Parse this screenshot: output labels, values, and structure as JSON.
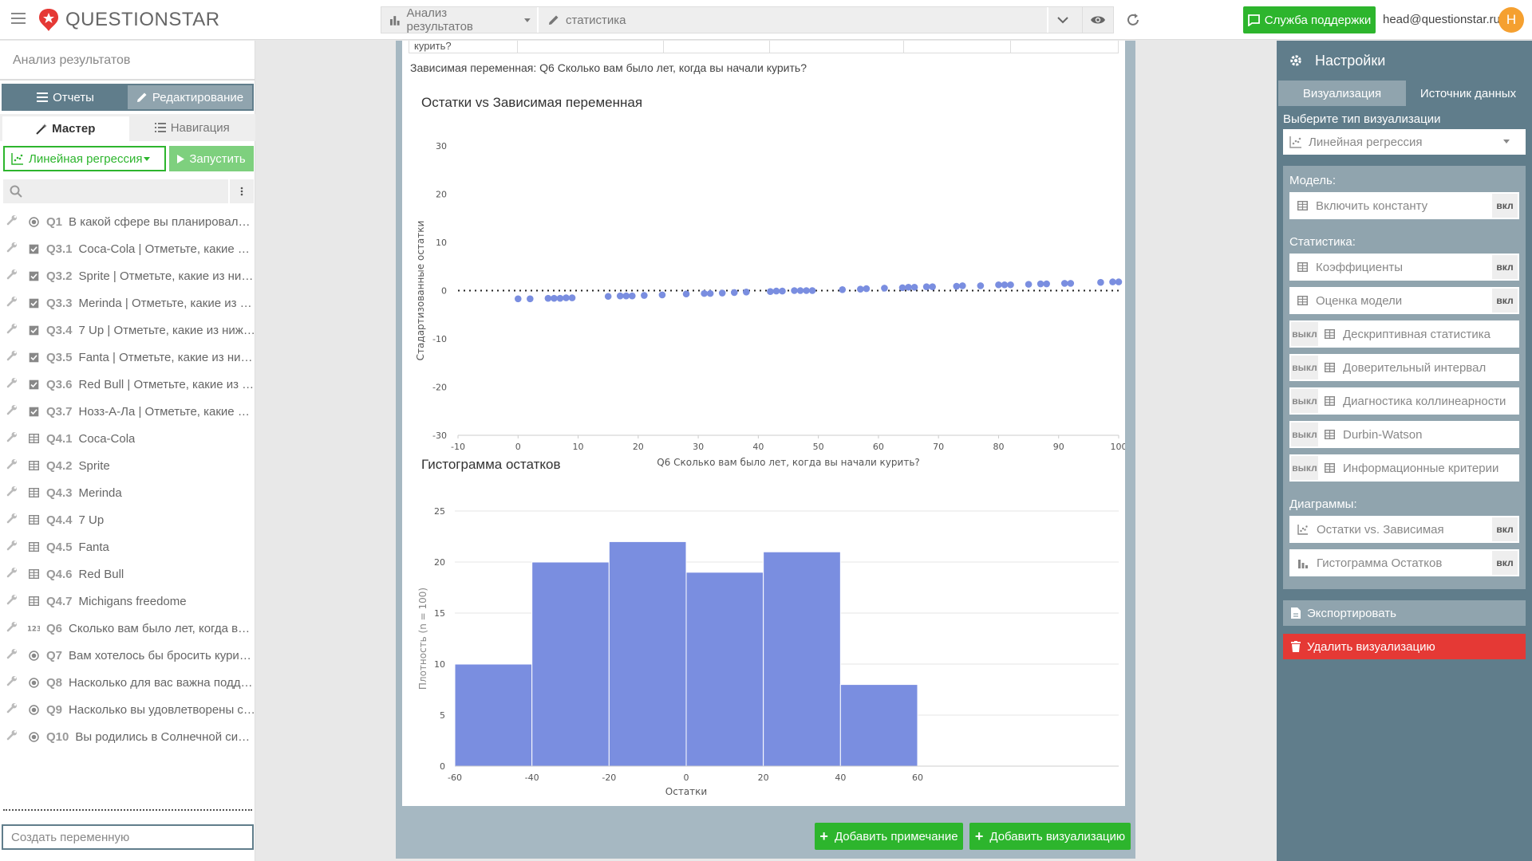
{
  "topbar": {
    "logo_text": "QUESTIONSTAR",
    "crumb_analysis": "Анализ результатов",
    "crumb_name": "статистика",
    "support_label": "Служба поддержки",
    "user_email": "head@questionstar.ru",
    "avatar_letter": "H",
    "brand_color": "#e53935",
    "accent_color": "#2db52d"
  },
  "sidebar": {
    "title": "Анализ результатов",
    "tab_reports": "Отчеты",
    "tab_edit": "Редактирование",
    "subtab_master": "Мастер",
    "subtab_nav": "Навигация",
    "analysis_type": "Линейная регрессия",
    "run_label": "Запустить",
    "new_var_placeholder": "Создать переменную",
    "items": [
      {
        "code": "Q1",
        "name": "В какой сфере вы планировали п...",
        "icon": "radio-icon"
      },
      {
        "code": "Q3.1",
        "name": "Coca-Cola | Отметьте, какие из ...",
        "icon": "checkbox-icon"
      },
      {
        "code": "Q3.2",
        "name": "Sprite | Отметьте, какие из ниже...",
        "icon": "checkbox-icon"
      },
      {
        "code": "Q3.3",
        "name": "Merinda | Отметьте, какие из ни...",
        "icon": "checkbox-icon"
      },
      {
        "code": "Q3.4",
        "name": "7 Up | Отметьте, какие из нижеп...",
        "icon": "checkbox-icon"
      },
      {
        "code": "Q3.5",
        "name": "Fanta | Отметьте, какие из ниже...",
        "icon": "checkbox-icon"
      },
      {
        "code": "Q3.6",
        "name": "Red Bull | Отметьте, какие из ни...",
        "icon": "checkbox-icon"
      },
      {
        "code": "Q3.7",
        "name": "Нозз-А-Ла | Отметьте, какие из ...",
        "icon": "checkbox-icon"
      },
      {
        "code": "Q4.1",
        "name": "Coca-Cola",
        "icon": "table-icon"
      },
      {
        "code": "Q4.2",
        "name": "Sprite",
        "icon": "table-icon"
      },
      {
        "code": "Q4.3",
        "name": "Merinda",
        "icon": "table-icon"
      },
      {
        "code": "Q4.4",
        "name": "7 Up",
        "icon": "table-icon"
      },
      {
        "code": "Q4.5",
        "name": "Fanta",
        "icon": "table-icon"
      },
      {
        "code": "Q4.6",
        "name": "Red Bull",
        "icon": "table-icon"
      },
      {
        "code": "Q4.7",
        "name": "Michigans freedome",
        "icon": "table-icon"
      },
      {
        "code": "Q6",
        "name": "Сколько вам было лет, когда вы ...",
        "icon": "numeric-icon"
      },
      {
        "code": "Q7",
        "name": "Вам хотелось бы бросить курить?",
        "icon": "radio-icon"
      },
      {
        "code": "Q8",
        "name": "Насколько для вас важна поддер...",
        "icon": "radio-icon"
      },
      {
        "code": "Q9",
        "name": "Насколько вы удовлетворены ст...",
        "icon": "radio-icon"
      },
      {
        "code": "Q10",
        "name": "Вы родились в Солнечной систе...",
        "icon": "radio-icon"
      }
    ]
  },
  "main": {
    "table_stub_text": "курить?",
    "dependent_var_text": "Зависимая переменная: Q6 Сколько вам было лет, когда вы начали курить?",
    "add_note_label": "Добавить примечание",
    "add_viz_label": "Добавить визуализацию"
  },
  "chart_data": [
    {
      "type": "scatter",
      "title": "Остатки vs Зависимая переменная",
      "xlabel": "Q6 Сколько вам было лет, когда вы начали курить?",
      "ylabel": "Стадартизованные остатки",
      "xlim": [
        -10,
        100
      ],
      "ylim": [
        -30,
        30
      ],
      "xticks": [
        -10,
        0,
        10,
        20,
        30,
        40,
        50,
        60,
        70,
        80,
        90,
        100
      ],
      "yticks": [
        30,
        20,
        10,
        0,
        -10,
        -20,
        -30
      ],
      "reference_line_y": 0,
      "color": "#7a8ee0",
      "points": [
        [
          0,
          -1.7
        ],
        [
          2,
          -1.7
        ],
        [
          5,
          -1.6
        ],
        [
          6,
          -1.6
        ],
        [
          7,
          -1.6
        ],
        [
          8,
          -1.5
        ],
        [
          9,
          -1.5
        ],
        [
          15,
          -1.2
        ],
        [
          17,
          -1.1
        ],
        [
          18,
          -1.1
        ],
        [
          19,
          -1.1
        ],
        [
          21,
          -1.0
        ],
        [
          24,
          -0.9
        ],
        [
          28,
          -0.7
        ],
        [
          31,
          -0.6
        ],
        [
          32,
          -0.6
        ],
        [
          34,
          -0.5
        ],
        [
          36,
          -0.4
        ],
        [
          38,
          -0.3
        ],
        [
          42,
          -0.2
        ],
        [
          43,
          -0.1
        ],
        [
          44,
          -0.1
        ],
        [
          46,
          0.0
        ],
        [
          47,
          0.0
        ],
        [
          48,
          0.0
        ],
        [
          49,
          0.0
        ],
        [
          54,
          0.2
        ],
        [
          57,
          0.3
        ],
        [
          58,
          0.4
        ],
        [
          61,
          0.5
        ],
        [
          64,
          0.6
        ],
        [
          65,
          0.7
        ],
        [
          66,
          0.7
        ],
        [
          68,
          0.8
        ],
        [
          69,
          0.8
        ],
        [
          73,
          0.9
        ],
        [
          74,
          1.0
        ],
        [
          77,
          1.0
        ],
        [
          80,
          1.2
        ],
        [
          81,
          1.2
        ],
        [
          82,
          1.2
        ],
        [
          85,
          1.3
        ],
        [
          87,
          1.4
        ],
        [
          88,
          1.4
        ],
        [
          91,
          1.5
        ],
        [
          92,
          1.5
        ],
        [
          97,
          1.7
        ],
        [
          99,
          1.8
        ],
        [
          100,
          1.8
        ]
      ]
    },
    {
      "type": "bar",
      "title": "Гистограмма остатков",
      "xlabel": "Остатки",
      "ylabel": "Плотность (n = 100)",
      "xlim": [
        -60,
        80
      ],
      "ylim": [
        0,
        25
      ],
      "xticks": [
        -60,
        -40,
        -20,
        0,
        20,
        40,
        60
      ],
      "yticks": [
        0,
        5,
        10,
        15,
        20,
        25
      ],
      "color": "#7a8ee0",
      "bins": [
        {
          "from": -60,
          "to": -40,
          "value": 10
        },
        {
          "from": -40,
          "to": -20,
          "value": 20
        },
        {
          "from": -20,
          "to": 0,
          "value": 22
        },
        {
          "from": 0,
          "to": 20,
          "value": 19
        },
        {
          "from": 20,
          "to": 40,
          "value": 21
        },
        {
          "from": 40,
          "to": 60,
          "value": 8
        }
      ]
    }
  ],
  "settings": {
    "title": "Настройки",
    "tab_viz": "Визуализация",
    "tab_source": "Источник данных",
    "viz_type_label": "Выберите тип визуализации",
    "viz_type_value": "Линейная регрессия",
    "model_label": "Модель:",
    "stats_label": "Статистика:",
    "charts_label": "Диаграммы:",
    "on_text": "вкл",
    "off_text": "выкл",
    "model_items": [
      {
        "label": "Включить константу",
        "state": "on"
      }
    ],
    "stats_items": [
      {
        "label": "Коэффициенты",
        "state": "on"
      },
      {
        "label": "Оценка модели",
        "state": "on"
      },
      {
        "label": "Дескриптивная статистика",
        "state": "off"
      },
      {
        "label": "Доверительный интервал",
        "state": "off"
      },
      {
        "label": "Диагностика коллинеарности",
        "state": "off"
      },
      {
        "label": "Durbin-Watson",
        "state": "off"
      },
      {
        "label": "Информационные критерии",
        "state": "off"
      }
    ],
    "chart_items": [
      {
        "label": "Остатки vs. Зависимая",
        "state": "on",
        "icon": "scatter-icon"
      },
      {
        "label": "Гистограмма Остатков",
        "state": "on",
        "icon": "bar-chart-icon"
      }
    ],
    "export_label": "Экспортировать",
    "delete_label": "Удалить визуализацию"
  }
}
